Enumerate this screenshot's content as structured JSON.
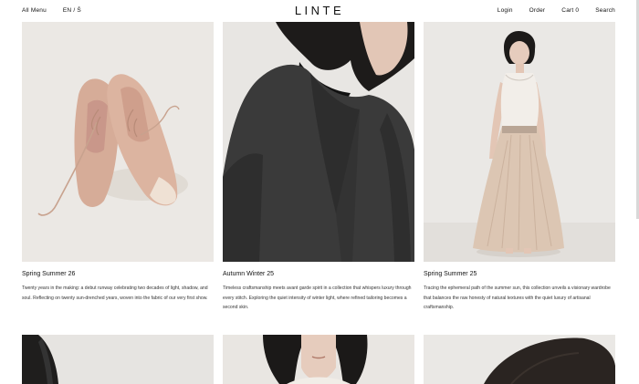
{
  "header": {
    "all_menu": "All Menu",
    "language": "EN / Ŝ",
    "logo": "LINTE",
    "login": "Login",
    "order": "Order",
    "cart": "Cart 0",
    "search": "Search"
  },
  "collections": [
    {
      "title": "Spring Summer 26",
      "description": "Twenty years in the making: a debut runway celebrating two decades of light, shadow, and soul. Reflecting on twenty sun-drenched years, woven into the fabric of our very first show."
    },
    {
      "title": "Autumn Winter 25",
      "description": "Timeless craftsmanship meets avant garde spirit in a collection that whispers luxury through every stitch. Exploring the quiet intensity of winter light, where refined tailoring becomes a second skin."
    },
    {
      "title": "Spring Summer 25",
      "description": "Tracing the ephemeral path of the summer sun, this collection unveils a visionary wardrobe that balances the raw honesty of natural textures with the quiet luxury of artisanal craftsmanship."
    }
  ],
  "colors": {
    "background": "#ffffff",
    "text": "#111111",
    "photo_bg": "#e9e7e4"
  }
}
